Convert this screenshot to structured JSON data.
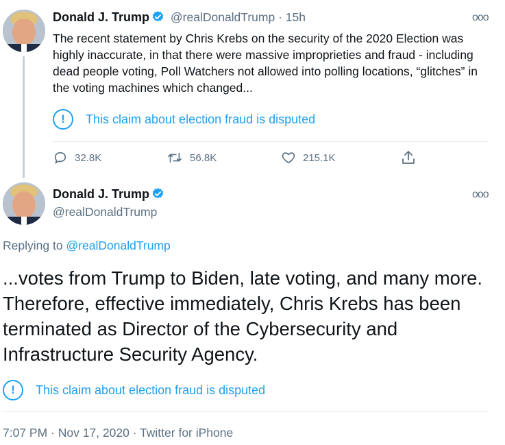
{
  "tweet1": {
    "author_name": "Donald J. Trump",
    "handle": "@realDonaldTrump",
    "dot": "·",
    "time_ago": "15h",
    "text": "The recent statement by Chris Krebs on the security of the 2020 Election was highly inaccurate, in that there were massive improprieties and fraud - including dead people voting, Poll Watchers not allowed into polling locations, “glitches” in the voting machines which changed...",
    "notice_label": "This claim about election fraud is disputed",
    "actions": {
      "replies": "32.8K",
      "retweets": "56.8K",
      "likes": "215.1K"
    }
  },
  "tweet2": {
    "author_name": "Donald J. Trump",
    "handle": "@realDonaldTrump",
    "replying_prefix": "Replying to ",
    "replying_handle": "@realDonaldTrump",
    "text": "...votes from Trump to Biden, late voting, and many more. Therefore, effective immediately, Chris Krebs has been terminated as Director of the Cybersecurity and Infrastructure Security Agency.",
    "notice_label": "This claim about election fraud is disputed",
    "meta": "7:07 PM · Nov 17, 2020 · Twitter for iPhone"
  },
  "icons": {
    "more": "ooo",
    "notice": "!"
  },
  "colors": {
    "accent": "#1da1f2",
    "secondary_text": "#5b7083",
    "primary_text": "#0f1419",
    "divider": "#e6ecf0"
  }
}
